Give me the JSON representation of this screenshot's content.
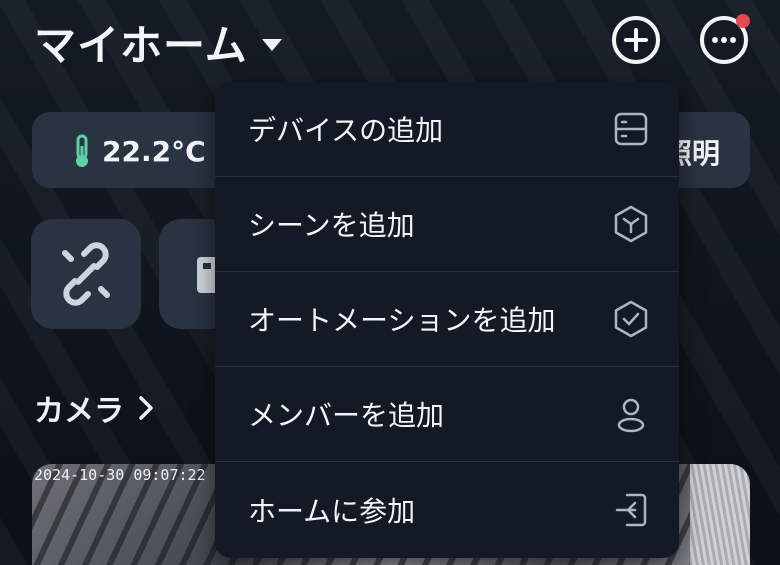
{
  "header": {
    "title": "マイホーム",
    "caret_icon": "chevron-down-icon",
    "add_icon": "plus-circle-icon",
    "more_icon": "more-horizontal-icon",
    "notification_color": "#e5484d"
  },
  "summary": {
    "temperature": "22.2°C",
    "thermometer_icon": "thermometer-icon",
    "thermometer_color": "#5fd1a4",
    "lighting_label": "照明"
  },
  "quick_actions": [
    {
      "icon": "unlink-icon"
    },
    {
      "icon": "device-icon"
    }
  ],
  "camera": {
    "section_label": "カメラ",
    "timestamp": "2024-10-30 09:07:22"
  },
  "menu": {
    "items": [
      {
        "label": "デバイスの追加",
        "icon": "device-panel-icon"
      },
      {
        "label": "シーンを追加",
        "icon": "scene-hexagon-icon"
      },
      {
        "label": "オートメーションを追加",
        "icon": "automation-check-icon"
      },
      {
        "label": "メンバーを追加",
        "icon": "person-icon"
      },
      {
        "label": "ホームに参加",
        "icon": "sign-in-icon"
      }
    ]
  }
}
